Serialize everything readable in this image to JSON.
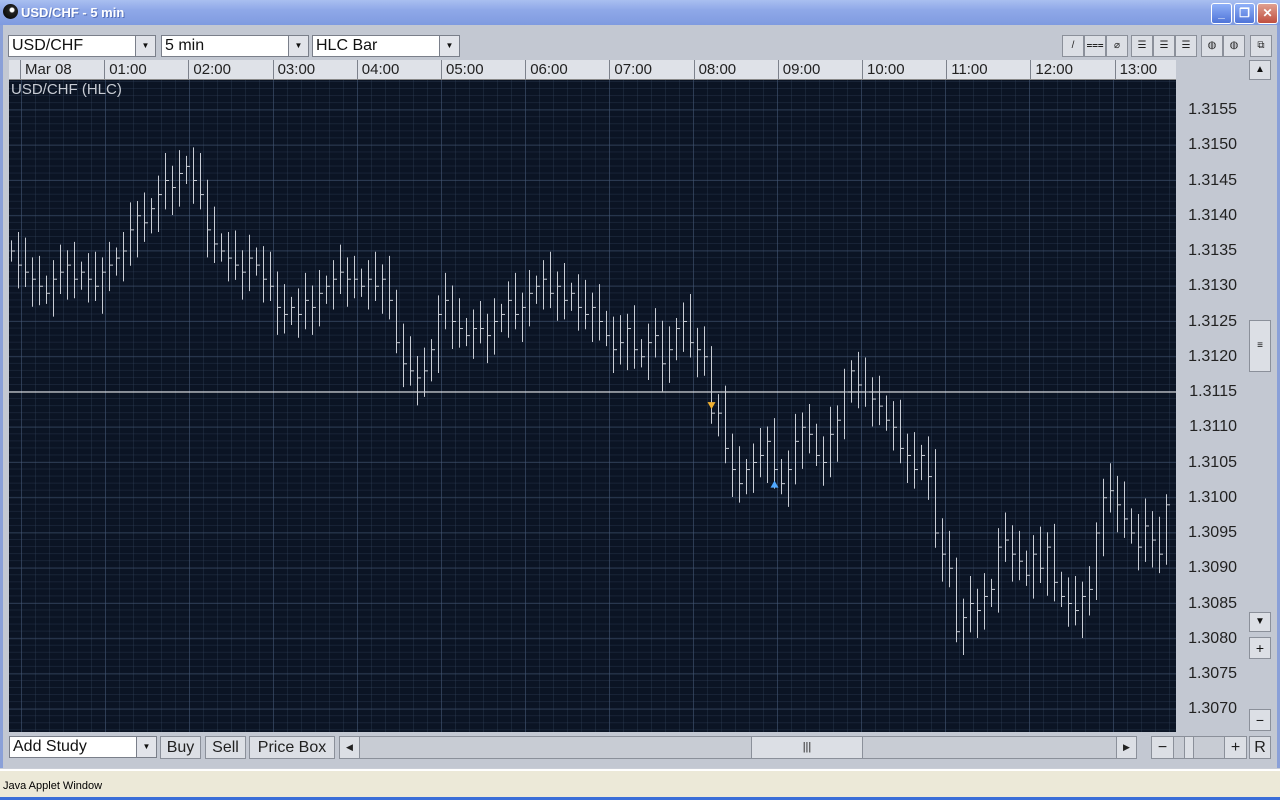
{
  "window": {
    "title": "USD/CHF  - 5 min",
    "minimize": "_",
    "maximize": "❐",
    "close": "✕"
  },
  "toolbar": {
    "symbol": "USD/CHF",
    "interval": "5 min",
    "chart_type": "HLC Bar",
    "tools": [
      "/",
      "⩶",
      "⌀",
      "☰",
      "☰",
      "☰",
      "◍",
      "◍"
    ],
    "detach": "⧉"
  },
  "time_axis": [
    "Mar 08",
    "01:00",
    "02:00",
    "03:00",
    "04:00",
    "05:00",
    "06:00",
    "07:00",
    "08:00",
    "09:00",
    "10:00",
    "11:00",
    "12:00",
    "13:00"
  ],
  "chart_label": "USD/CHF (HLC)",
  "price_axis": [
    "1.3155",
    "1.3150",
    "1.3145",
    "1.3140",
    "1.3135",
    "1.3130",
    "1.3125",
    "1.3120",
    "1.3115",
    "1.3110",
    "1.3105",
    "1.3100",
    "1.3095",
    "1.3090",
    "1.3085",
    "1.3080",
    "1.3075",
    "1.3070"
  ],
  "bottom": {
    "study": "Add Study",
    "buy": "Buy",
    "sell": "Sell",
    "price_box": "Price Box",
    "reset": "R"
  },
  "status": "Java Applet Window",
  "colors": {
    "bg": "#0b1424",
    "bar": "#c8ccd4",
    "line": "#ffffff",
    "sell": "#f0b030",
    "buy": "#50a8ff"
  },
  "chart_data": {
    "type": "hlc_bar",
    "title": "USD/CHF (HLC)",
    "interval": "5 min",
    "ylim": [
      1.3066,
      1.3159
    ],
    "bar_half_range_pips": 3,
    "horizontal_line": 1.3115,
    "markers": [
      {
        "type": "sell",
        "bar": 100,
        "price": 1.3113
      },
      {
        "type": "buy",
        "bar": 109,
        "price": 1.3102
      }
    ],
    "close": [
      1.3135,
      1.3133,
      1.3132,
      1.3131,
      1.313,
      1.3129,
      1.3131,
      1.3132,
      1.3133,
      1.3131,
      1.3132,
      1.3131,
      1.313,
      1.3132,
      1.3133,
      1.3134,
      1.3135,
      1.3138,
      1.314,
      1.3139,
      1.3141,
      1.3143,
      1.3145,
      1.3144,
      1.3146,
      1.3147,
      1.3145,
      1.3143,
      1.3138,
      1.3136,
      1.3135,
      1.3134,
      1.3133,
      1.3132,
      1.3134,
      1.3133,
      1.3131,
      1.313,
      1.3127,
      1.3126,
      1.3127,
      1.3126,
      1.3128,
      1.3127,
      1.3129,
      1.313,
      1.3131,
      1.3132,
      1.3131,
      1.3131,
      1.313,
      1.3131,
      1.313,
      1.3131,
      1.3128,
      1.3122,
      1.3119,
      1.3118,
      1.3117,
      1.3118,
      1.3121,
      1.3126,
      1.3128,
      1.3125,
      1.3124,
      1.3123,
      1.3124,
      1.3124,
      1.3123,
      1.3125,
      1.3126,
      1.3128,
      1.3126,
      1.3127,
      1.3129,
      1.313,
      1.3131,
      1.3129,
      1.313,
      1.3128,
      1.3129,
      1.3127,
      1.3126,
      1.3127,
      1.3125,
      1.3123,
      1.3121,
      1.3122,
      1.3124,
      1.3121,
      1.312,
      1.3122,
      1.3123,
      1.3119,
      1.3121,
      1.3124,
      1.3125,
      1.3122,
      1.3121,
      1.312,
      1.3112,
      1.3112,
      1.3107,
      1.3104,
      1.3102,
      1.3104,
      1.3105,
      1.3106,
      1.3108,
      1.3104,
      1.3102,
      1.3104,
      1.3108,
      1.311,
      1.3109,
      1.3106,
      1.3105,
      1.3109,
      1.3111,
      1.3115,
      1.3118,
      1.3116,
      1.3115,
      1.3114,
      1.3113,
      1.3111,
      1.311,
      1.3107,
      1.3106,
      1.3104,
      1.3106,
      1.3103,
      1.3095,
      1.3092,
      1.309,
      1.3081,
      1.3083,
      1.3085,
      1.3084,
      1.3086,
      1.3087,
      1.3093,
      1.3094,
      1.3092,
      1.3091,
      1.3089,
      1.3092,
      1.309,
      1.3093,
      1.3088,
      1.3086,
      1.3085,
      1.3084,
      1.3086,
      1.3087,
      1.3095,
      1.31,
      1.3101,
      1.3099,
      1.3097,
      1.3095,
      1.3093,
      1.3096,
      1.3094,
      1.3092,
      1.3099
    ]
  }
}
